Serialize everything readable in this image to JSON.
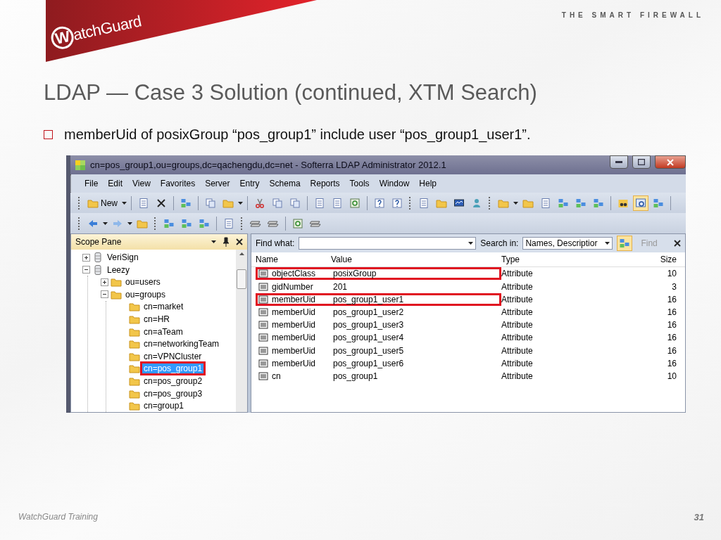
{
  "slide": {
    "brand": "WatchGuard",
    "tagline": "THE SMART FIREWALL",
    "title": "LDAP — Case 3 Solution (continued, XTM Search)",
    "bullet": "memberUid of posixGroup “pos_group1” include user “pos_group1_user1”.",
    "footer": "WatchGuard Training",
    "page": "31"
  },
  "window": {
    "title": "cn=pos_group1,ou=groups,dc=qachengdu,dc=net - Softerra LDAP Administrator 2012.1"
  },
  "menu": [
    "File",
    "Edit",
    "View",
    "Favorites",
    "Server",
    "Entry",
    "Schema",
    "Reports",
    "Tools",
    "Window",
    "Help"
  ],
  "toolbar": {
    "new_label": "New",
    "search_toggle": {
      "selected": true
    }
  },
  "scope_pane": {
    "title": "Scope Pane",
    "tree": [
      {
        "label": "VeriSign",
        "kind": "server",
        "expanded": false,
        "selected": false
      },
      {
        "label": "Leezy",
        "kind": "server",
        "expanded": true,
        "selected": false,
        "children": [
          {
            "label": "ou=users",
            "kind": "folder",
            "expanded": false,
            "selected": false
          },
          {
            "label": "ou=groups",
            "kind": "folder",
            "expanded": true,
            "selected": false,
            "children": [
              {
                "label": "cn=market",
                "kind": "folder",
                "selected": false
              },
              {
                "label": "cn=HR",
                "kind": "folder",
                "selected": false
              },
              {
                "label": "cn=aTeam",
                "kind": "folder",
                "selected": false
              },
              {
                "label": "cn=networkingTeam",
                "kind": "folder",
                "selected": false
              },
              {
                "label": "cn=VPNCluster",
                "kind": "folder",
                "selected": false
              },
              {
                "label": "cn=pos_group1",
                "kind": "folder",
                "selected": true,
                "highlighted": true
              },
              {
                "label": "cn=pos_group2",
                "kind": "folder",
                "selected": false
              },
              {
                "label": "cn=pos_group3",
                "kind": "folder",
                "selected": false
              },
              {
                "label": "cn=group1",
                "kind": "folder",
                "selected": false
              }
            ]
          }
        ]
      }
    ]
  },
  "search": {
    "find_label": "Find what:",
    "search_in_label": "Search in:",
    "search_in_value": "Names, Descriptior",
    "find_button": "Find"
  },
  "table": {
    "columns": [
      "Name",
      "Value",
      "Type",
      "Size"
    ],
    "rows": [
      {
        "name": "objectClass",
        "value": "posixGroup",
        "type": "Attribute",
        "size": "10",
        "highlighted": true
      },
      {
        "name": "gidNumber",
        "value": "201",
        "type": "Attribute",
        "size": "3",
        "highlighted": false
      },
      {
        "name": "memberUid",
        "value": "pos_group1_user1",
        "type": "Attribute",
        "size": "16",
        "highlighted": true
      },
      {
        "name": "memberUid",
        "value": "pos_group1_user2",
        "type": "Attribute",
        "size": "16",
        "highlighted": false
      },
      {
        "name": "memberUid",
        "value": "pos_group1_user3",
        "type": "Attribute",
        "size": "16",
        "highlighted": false
      },
      {
        "name": "memberUid",
        "value": "pos_group1_user4",
        "type": "Attribute",
        "size": "16",
        "highlighted": false
      },
      {
        "name": "memberUid",
        "value": "pos_group1_user5",
        "type": "Attribute",
        "size": "16",
        "highlighted": false
      },
      {
        "name": "memberUid",
        "value": "pos_group1_user6",
        "type": "Attribute",
        "size": "16",
        "highlighted": false
      },
      {
        "name": "cn",
        "value": "pos_group1",
        "type": "Attribute",
        "size": "10",
        "highlighted": false
      }
    ]
  }
}
